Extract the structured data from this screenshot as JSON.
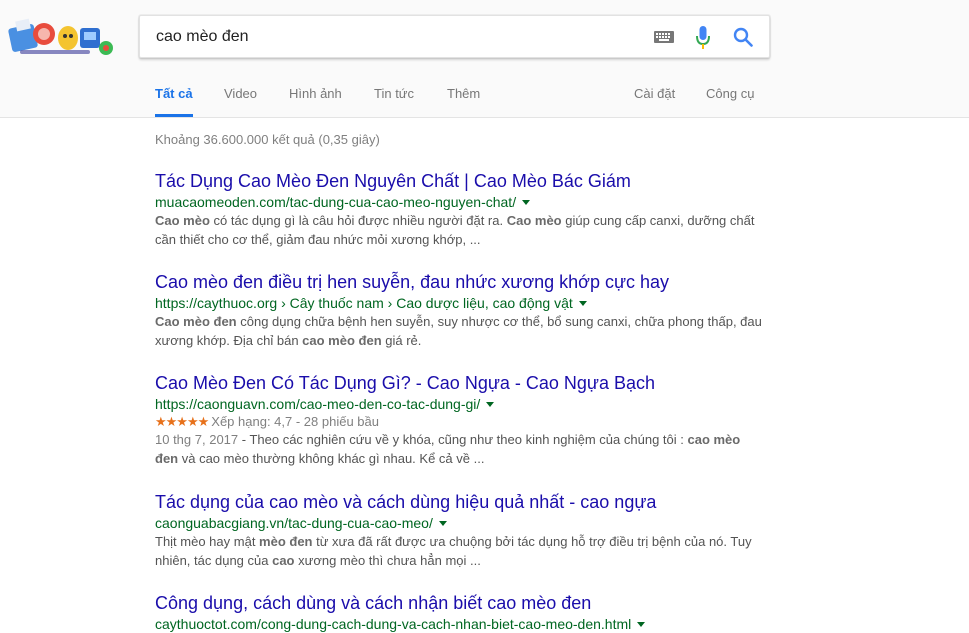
{
  "search": {
    "query": "cao mèo đen"
  },
  "tabs": {
    "all": "Tất cả",
    "video": "Video",
    "images": "Hình ảnh",
    "news": "Tin tức",
    "more": "Thêm",
    "settings": "Cài đặt",
    "tools": "Công cụ"
  },
  "stats": "Khoảng 36.600.000 kết quả (0,35 giây)",
  "results": [
    {
      "title": "Tác Dụng Cao Mèo Đen Nguyên Chất | Cao Mèo Bác Giám",
      "url": "muacaomeoden.com/tac-dung-cua-cao-meo-nguyen-chat/",
      "snippet": [
        "Cao mèo",
        " có tác dụng gì là câu hỏi được nhiều người đặt ra. ",
        "Cao mèo",
        " giúp cung cấp canxi, dưỡng chất cần thiết cho cơ thể, giảm đau nhức mỏi xương khớp, ..."
      ]
    },
    {
      "title": "Cao mèo đen điều trị hen suyễn, đau nhức xương khớp cực hay",
      "url": "https://caythuoc.org › Cây thuốc nam › Cao dược liệu, cao động vật",
      "snippet": [
        "Cao mèo đen",
        " công dụng chữa bệnh hen suyễn, suy nhược cơ thể, bổ sung canxi, chữa phong thấp, đau xương khớp. Địa chỉ bán ",
        "cao mèo đen",
        " giá rẻ."
      ]
    },
    {
      "title": "Cao Mèo Đen Có Tác Dụng Gì? - Cao Ngựa - Cao Ngựa Bạch",
      "url": "https://caonguavn.com/cao-meo-den-co-tac-dung-gi/",
      "rating_stars": "★★★★★",
      "rating_value": 4.7,
      "rating_text": "Xếp hạng: 4,7 - 28 phiếu bầu",
      "date": "10 thg 7, 2017",
      "snippet": [
        " - Theo các nghiên cứu về y khóa, cũng như theo kinh nghiệm của chúng tôi : ",
        "cao mèo đen",
        " và cao mèo thường không khác gì nhau. Kể cả về ..."
      ]
    },
    {
      "title": "Tác dụng của cao mèo và cách dùng hiệu quả nhất - cao ngựa",
      "url": "caonguabacgiang.vn/tac-dung-cua-cao-meo/",
      "snippet": [
        "Thịt mèo hay mật ",
        "mèo đen",
        " từ xưa đã rất được ưa chuộng bởi tác dụng hỗ trợ điều trị bệnh của nó. Tuy nhiên, tác dụng của ",
        "cao",
        " xương mèo thì chưa hẳn mọi ..."
      ]
    },
    {
      "title": "Công dụng, cách dùng và cách nhận biết cao mèo đen",
      "url": "caythuoctot.com/cong-dung-cach-dung-va-cach-nhan-biet-cao-meo-den.html"
    }
  ]
}
